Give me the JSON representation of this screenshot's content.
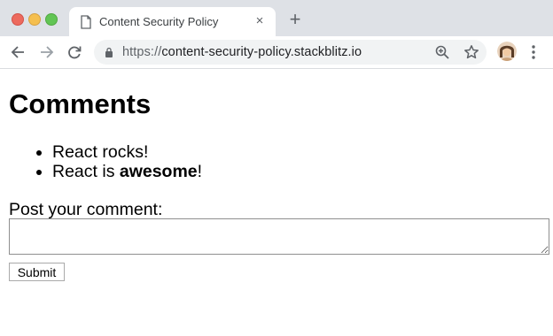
{
  "browser": {
    "tab_title": "Content Security Policy",
    "tab_close": "×",
    "new_tab": "+",
    "url_scheme": "https://",
    "url_host": "content-security-policy.stackblitz.io",
    "icons": [
      "back-arrow-icon",
      "forward-arrow-icon",
      "reload-icon",
      "lock-icon",
      "zoom-icon",
      "star-icon",
      "profile-avatar",
      "menu-icon"
    ]
  },
  "page": {
    "heading": "Comments",
    "comments": [
      {
        "text": "React rocks!"
      },
      {
        "prefix": "React is ",
        "bold": "awesome",
        "suffix": "!"
      }
    ],
    "post_label": "Post your comment:",
    "comment_value": "",
    "submit_label": "Submit"
  }
}
